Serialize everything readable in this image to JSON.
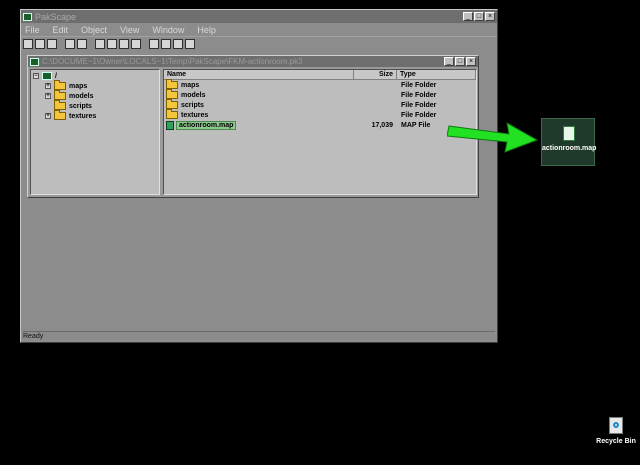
{
  "app": {
    "title": "PakScape",
    "menu": [
      "File",
      "Edit",
      "Object",
      "View",
      "Window",
      "Help"
    ],
    "status": "Ready"
  },
  "explorer": {
    "title": "C:\\DOCUME~1\\Owner\\LOCALS~1\\Temp\\PakScape\\FKM-actionroom.pk3",
    "tree": [
      {
        "label": "/",
        "root": true
      },
      {
        "label": "maps"
      },
      {
        "label": "models"
      },
      {
        "label": "scripts"
      },
      {
        "label": "textures"
      }
    ],
    "columns": {
      "name": "Name",
      "size": "Size",
      "type": "Type"
    },
    "files": [
      {
        "name": "maps",
        "size": "",
        "type": "File Folder"
      },
      {
        "name": "models",
        "size": "",
        "type": "File Folder"
      },
      {
        "name": "scripts",
        "size": "",
        "type": "File Folder"
      },
      {
        "name": "textures",
        "size": "",
        "type": "File Folder"
      },
      {
        "name": "actionroom.map",
        "size": "17,039",
        "type": "MAP File",
        "selected": true
      }
    ]
  },
  "desktop": {
    "file_label": "actionroom.map",
    "recycle_label": "Recycle Bin"
  },
  "colors": {
    "arrow": "#22e022",
    "selection": "#8fc88f"
  },
  "icons": [
    "pakscape-app-icon",
    "folder-icon",
    "map-file-icon",
    "recycle-bin-icon",
    "green-arrow-icon"
  ]
}
